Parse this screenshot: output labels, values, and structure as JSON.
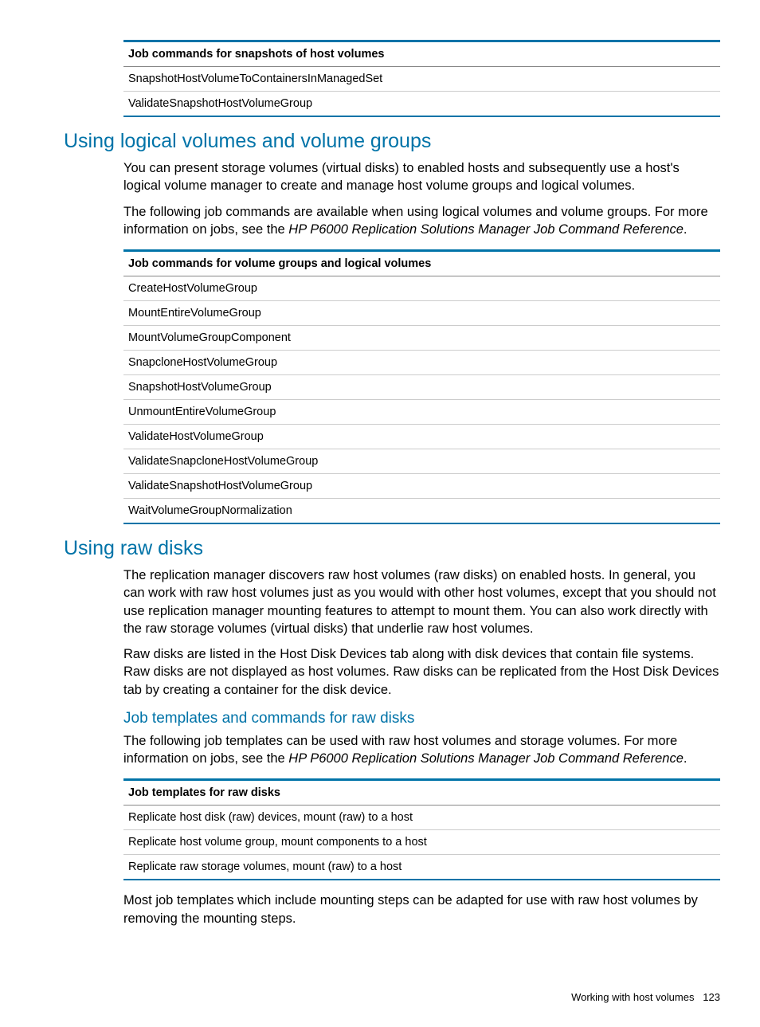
{
  "snapshot_table": {
    "header": "Job commands for snapshots of host volumes",
    "rows": [
      "SnapshotHostVolumeToContainersInManagedSet",
      "ValidateSnapshotHostVolumeGroup"
    ]
  },
  "section_logical": {
    "title": "Using logical volumes and volume groups",
    "para1": "You can present storage volumes (virtual disks) to enabled hosts and subsequently use a host's logical volume manager to create and manage host volume groups and logical volumes.",
    "para2_a": "The following job commands are available when using logical volumes and volume groups. For more information on jobs, see the ",
    "para2_ref": "HP P6000 Replication Solutions Manager Job Command Reference",
    "para2_b": "."
  },
  "volgroup_table": {
    "header": "Job commands for volume groups and logical volumes",
    "rows": [
      "CreateHostVolumeGroup",
      "MountEntireVolumeGroup",
      "MountVolumeGroupComponent",
      "SnapcloneHostVolumeGroup",
      "SnapshotHostVolumeGroup",
      "UnmountEntireVolumeGroup",
      "ValidateHostVolumeGroup",
      "ValidateSnapcloneHostVolumeGroup",
      "ValidateSnapshotHostVolumeGroup",
      "WaitVolumeGroupNormalization"
    ]
  },
  "section_raw": {
    "title": "Using raw disks",
    "para1": "The replication manager discovers raw host volumes (raw disks) on enabled hosts. In general, you can work with raw host volumes just as you would with other host volumes, except that you should not use replication manager mounting features to attempt to mount them. You can also work directly with the raw storage volumes (virtual disks) that underlie raw host volumes.",
    "para2": "Raw disks are listed in the Host Disk Devices tab along with disk devices that contain file systems. Raw disks are not displayed as host volumes. Raw disks can be replicated from the Host Disk Devices tab by creating a container for the disk device.",
    "subsection": "Job templates and commands for raw disks",
    "para3_a": "The following job templates can be used with raw host volumes and storage volumes. For more information on jobs, see the ",
    "para3_ref": "HP P6000 Replication Solutions Manager Job Command Reference",
    "para3_b": "."
  },
  "raw_templates_table": {
    "header": "Job templates for raw disks",
    "rows": [
      "Replicate host disk (raw) devices, mount (raw) to a host",
      "Replicate host volume group, mount components to a host",
      "Replicate raw storage volumes, mount (raw) to a host"
    ]
  },
  "closing_para": "Most job templates which include mounting steps can be adapted for use with raw host volumes by removing the mounting steps.",
  "footer": {
    "text": "Working with host volumes",
    "page": "123"
  }
}
